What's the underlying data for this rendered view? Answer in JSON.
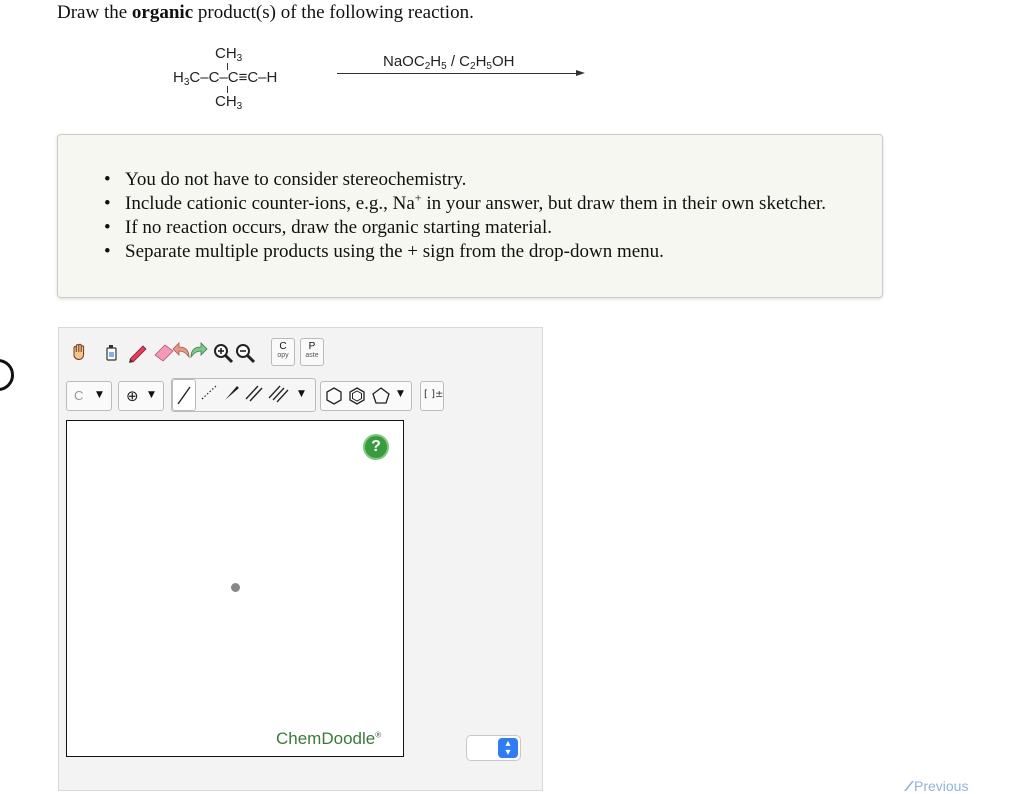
{
  "question": {
    "prefix": "Draw the ",
    "bold": "organic",
    "suffix": " product(s) of the following reaction."
  },
  "reaction": {
    "top_group": "CH",
    "top_sub": "3",
    "left_group": "H",
    "left_sub": "3",
    "main_chain": "C–C–C≡C–H",
    "bottom_group": "CH",
    "bottom_sub": "3",
    "reagent_a": "NaOC",
    "reagent_a_sub1": "2",
    "reagent_a_mid": "H",
    "reagent_a_sub2": "5",
    "reagent_sep": " / C",
    "reagent_b_sub1": "2",
    "reagent_b_mid": "H",
    "reagent_b_sub2": "5",
    "reagent_b_end": "OH"
  },
  "instructions": {
    "item1": "You do not have to consider stereochemistry.",
    "item2_a": "Include cationic counter-ions, e.g., Na",
    "item2_sup": "+",
    "item2_b": " in your answer, but draw them in their own sketcher.",
    "item3": "If no reaction occurs, draw the organic starting material.",
    "item4": "Separate multiple products using the + sign from the drop-down menu."
  },
  "sketcher": {
    "copy_top": "C",
    "copy_bottom": "opy",
    "paste_top": "P",
    "paste_bottom": "aste",
    "atom_label": "C",
    "charge_symbol": "⊕",
    "bracket_label": "[ ]±",
    "help_label": "?",
    "brand": "ChemDoodle",
    "brand_mark": "®",
    "icons": [
      "hand-icon",
      "eraser-bottle-icon",
      "pencil-icon",
      "eraser-icon",
      "undo-icon",
      "redo-icon",
      "zoom-in-icon",
      "zoom-out-icon"
    ]
  },
  "nav": {
    "previous": "Previous"
  }
}
